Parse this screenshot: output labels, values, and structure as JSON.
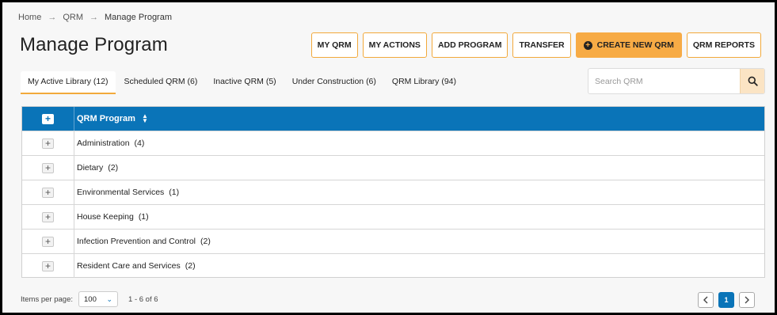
{
  "breadcrumb": {
    "items": [
      "Home",
      "QRM",
      "Manage Program"
    ]
  },
  "page": {
    "title": "Manage Program"
  },
  "actions": {
    "my_qrm": "MY QRM",
    "my_actions": "MY ACTIONS",
    "add_program": "ADD PROGRAM",
    "transfer": "TRANSFER",
    "create_new_qrm": "CREATE NEW QRM",
    "qrm_reports": "QRM REPORTS"
  },
  "tabs": [
    {
      "label": "My Active Library (12)",
      "active": true
    },
    {
      "label": "Scheduled QRM (6)",
      "active": false
    },
    {
      "label": "Inactive QRM (5)",
      "active": false
    },
    {
      "label": "Under Construction (6)",
      "active": false
    },
    {
      "label": "QRM Library (94)",
      "active": false
    }
  ],
  "search": {
    "placeholder": "Search QRM",
    "value": ""
  },
  "table": {
    "header": "QRM Program",
    "rows": [
      {
        "name": "Administration",
        "count": "(4)"
      },
      {
        "name": "Dietary",
        "count": "(2)"
      },
      {
        "name": "Environmental Services",
        "count": "(1)"
      },
      {
        "name": "House Keeping",
        "count": "(1)"
      },
      {
        "name": "Infection Prevention and Control",
        "count": "(2)"
      },
      {
        "name": "Resident Care and Services",
        "count": "(2)"
      }
    ]
  },
  "pagination": {
    "items_per_page_label": "Items per page:",
    "items_per_page_value": "100",
    "range": "1 - 6 of 6",
    "current_page": "1"
  },
  "colors": {
    "accent_orange": "#f7ab45",
    "header_blue": "#0a74b8"
  }
}
